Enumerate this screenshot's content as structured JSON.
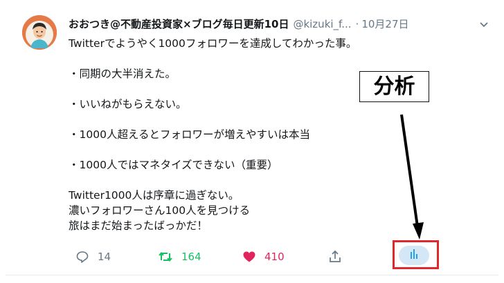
{
  "tweet": {
    "display_name": "おおつき@不動産投資家×ブログ毎日更新10日",
    "handle": "@kizuki_f...",
    "separator": "·",
    "date": "10月27日",
    "lines": [
      "Twitterでようやく1000フォロワーを達成してわかった事。",
      "",
      "・同期の大半消えた。",
      "",
      "・いいねがもらえない。",
      "",
      "・1000人超えるとフォロワーが増えやすいは本当",
      "",
      "・1000人ではマネタイズできない（重要）",
      "",
      "Twitter1000人は序章に過ぎない。",
      "濃いフォロワーさん100人を見つける",
      "旅はまだ始まったばっかだ！"
    ]
  },
  "actions": {
    "reply_count": "14",
    "retweet_count": "164",
    "like_count": "410"
  },
  "annotation": {
    "label": "分析"
  },
  "colors": {
    "retweet": "#17bf63",
    "like": "#e0245e",
    "muted": "#657786",
    "highlight": "#e3262b"
  }
}
